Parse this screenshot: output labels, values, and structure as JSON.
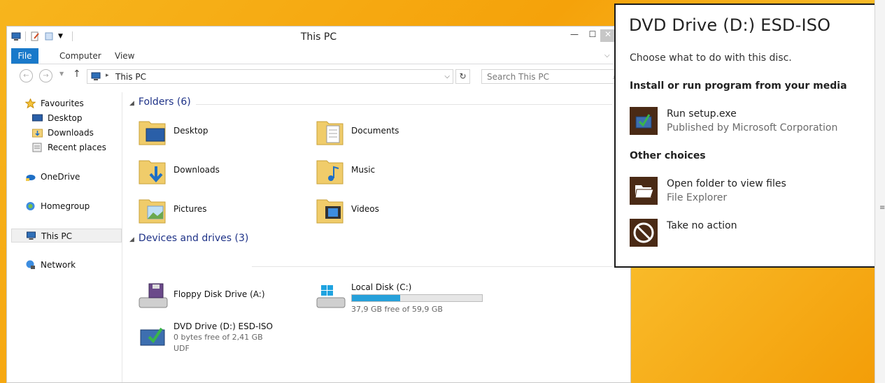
{
  "window": {
    "title": "This PC",
    "controls": {
      "minimize": "—",
      "maximize": "☐",
      "close": "✕"
    }
  },
  "ribbon": {
    "tabs": [
      {
        "label": "File"
      },
      {
        "label": "Computer"
      },
      {
        "label": "View"
      }
    ]
  },
  "navigation": {
    "address": "This PC",
    "search_placeholder": "Search This PC"
  },
  "sidebar": {
    "favourites": {
      "label": "Favourites",
      "items": [
        "Desktop",
        "Downloads",
        "Recent places"
      ]
    },
    "onedrive": "OneDrive",
    "homegroup": "Homegroup",
    "thispc": "This PC",
    "network": "Network"
  },
  "content": {
    "folders_header": "Folders (6)",
    "folders": [
      "Desktop",
      "Documents",
      "Downloads",
      "Music",
      "Pictures",
      "Videos"
    ],
    "devices_header": "Devices and drives (3)",
    "drives": [
      {
        "name": "Floppy Disk Drive (A:)"
      },
      {
        "name": "Local Disk (C:)",
        "free_text": "37,9 GB free of 59,9 GB",
        "used_fraction": 0.37
      },
      {
        "name": "DVD Drive (D:) ESD-ISO",
        "free_text": "0 bytes free of 2,41 GB",
        "fs": "UDF"
      }
    ]
  },
  "autoplay": {
    "title": "DVD Drive (D:) ESD-ISO",
    "description": "Choose what to do with this disc.",
    "section_install": "Install or run program from your media",
    "run_setup": {
      "title": "Run setup.exe",
      "subtitle": "Published by Microsoft Corporation"
    },
    "section_other": "Other choices",
    "open_folder": {
      "title": "Open folder to view files",
      "subtitle": "File Explorer"
    },
    "no_action": {
      "title": "Take no action"
    }
  },
  "colors": {
    "file_tab": "#1979ca",
    "group_header": "#1e3287",
    "capacity_fill": "#26a0da",
    "autoplay_icon_bg": "#4a2a15",
    "desktop": "#f5a60c"
  }
}
